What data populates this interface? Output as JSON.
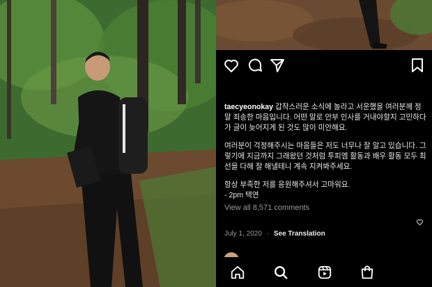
{
  "post": {
    "username": "taecyeonokay",
    "caption_lines": [
      "갑작스러운 소식에 놀라고 서운했을 여러분께 정말 죄송한 마음입니다. 어떤 말로 안부 인사를 거내야할지 고민하다가 글이 늦어지게 된 것도 많이 미안해요.",
      "여러분이 걱정해주시는 마음들은 저도 너무나 잘 알고 있습니다. 그렇기에 지금까지 그래왔던 것처럼 투피엠 활동과 배우 활동 모두 최선을 다해 잘 해낼테니 계속 지켜봐주세요.",
      "항상 부족한 저를 응원해주셔서 고마워요.",
      "- 2pm 택연"
    ],
    "comments_label": "View all 8,571 comments",
    "date": "July 1, 2020",
    "separator": "·",
    "see_translation": "See Translation"
  },
  "actions": {
    "like_icon": "heart-icon",
    "comment_icon": "comment-icon",
    "share_icon": "share-icon",
    "save_icon": "bookmark-icon"
  },
  "tabbar": {
    "items": [
      "home-icon",
      "search-icon",
      "reels-icon",
      "shop-icon"
    ]
  },
  "colors": {
    "background": "#000000",
    "text": "#e8e8e8",
    "muted": "#9a9a9a"
  }
}
